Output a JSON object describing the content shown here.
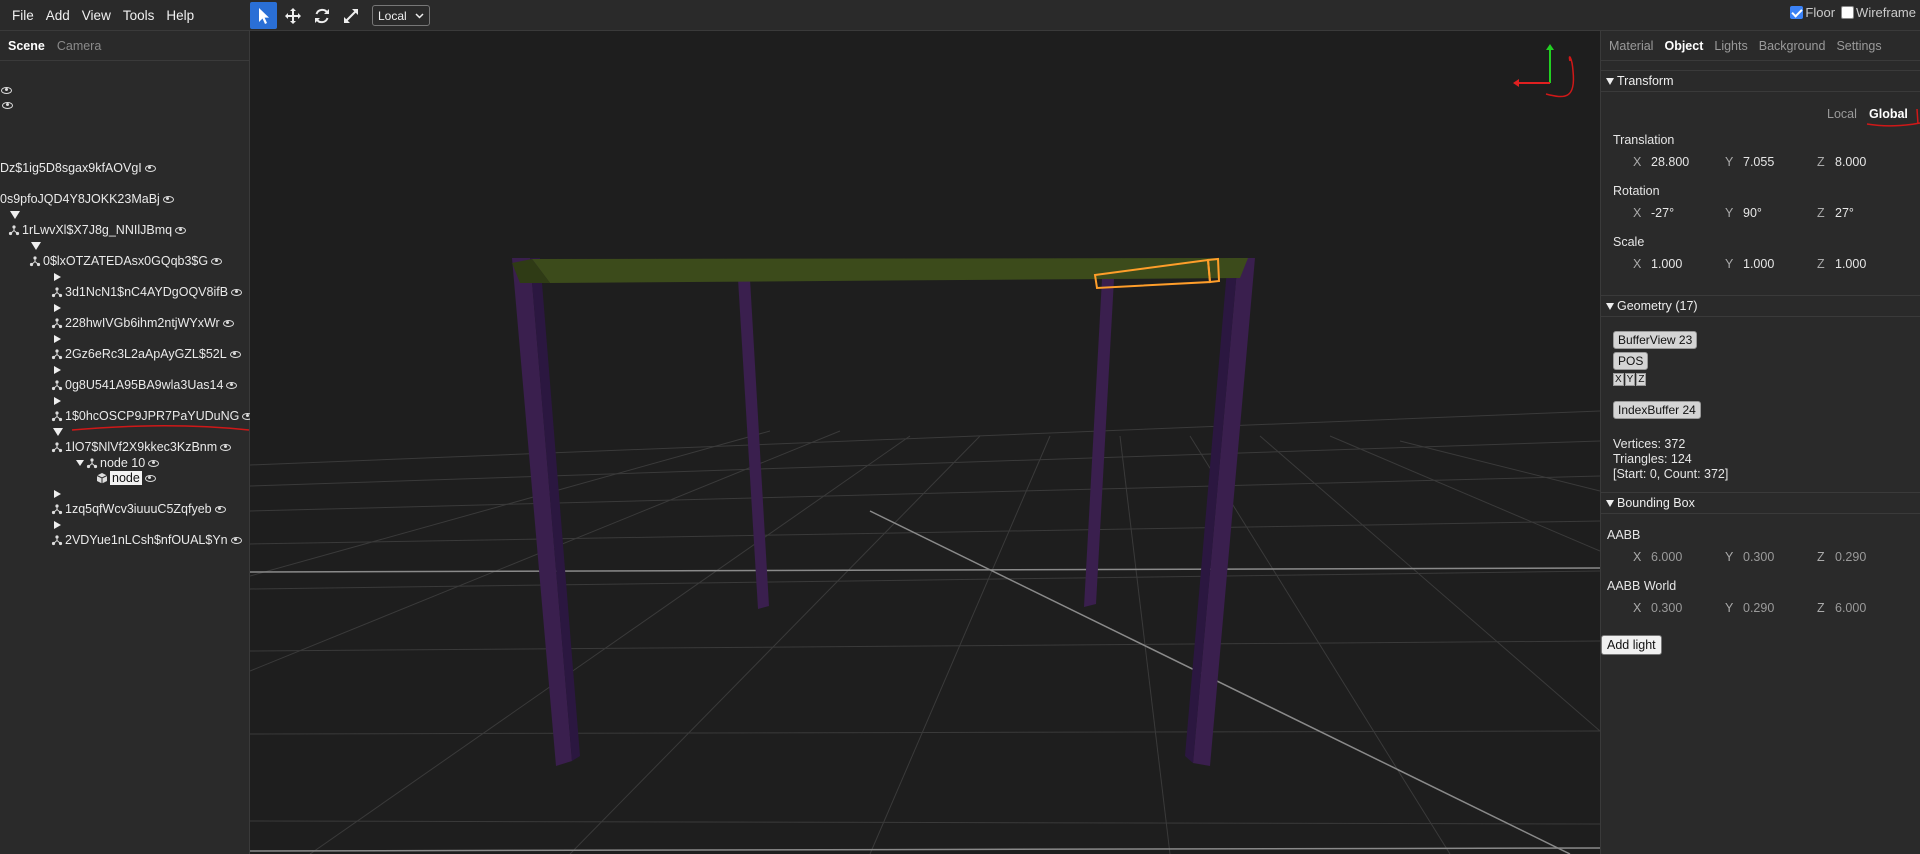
{
  "menu": [
    "File",
    "Add",
    "View",
    "Tools",
    "Help"
  ],
  "toolbar": {
    "space": "Local"
  },
  "toggles": {
    "floor": "Floor",
    "wireframe": "Wireframe"
  },
  "left_tabs": [
    "Scene",
    "Camera"
  ],
  "tree": [
    "Dz$1ig5D8sgax9kfAOVgI",
    "0s9pfoJQD4Y8JOKK23MaBj",
    "1rLwvXl$X7J8g_NNIlJBmq",
    "0$lxOTZATEDAsx0GQqb3$G",
    "3d1NcN1$nC4AYDgOQV8ifB",
    "228hwIVGb6ihm2ntjWYxWr",
    "2Gz6eRc3L2aApAyGZL$52L",
    "0g8U541A95BA9wla3Uas14",
    "1$0hcOSCP9JPR7PaYUDuNG",
    "1lO7$NlVf2X9kkec3KzBnm",
    "node 10",
    "node",
    "1zq5qfWcv3iuuuC5Zqfyeb",
    "2VDYue1nLCsh$nfOUAL$Yn"
  ],
  "right_tabs": [
    "Material",
    "Object",
    "Lights",
    "Background",
    "Settings"
  ],
  "transform": {
    "header": "Transform",
    "space_local": "Local",
    "space_global": "Global",
    "translation_label": "Translation",
    "translation": {
      "x": "28.800",
      "y": "7.055",
      "z": "8.000"
    },
    "rotation_label": "Rotation",
    "rotation": {
      "x": "-27°",
      "y": "90°",
      "z": "27°"
    },
    "scale_label": "Scale",
    "scale": {
      "x": "1.000",
      "y": "1.000",
      "z": "1.000"
    },
    "axes": {
      "x": "X",
      "y": "Y",
      "z": "Z"
    }
  },
  "geometry": {
    "header": "Geometry (17)",
    "buffer_view": "BufferView 23",
    "pos": "POS",
    "mini": [
      "X",
      "Y",
      "Z"
    ],
    "index_buffer": "IndexBuffer 24",
    "vertices": "Vertices: 372",
    "triangles": "Triangles: 124",
    "range": "[Start: 0, Count: 372]"
  },
  "bbox": {
    "header": "Bounding Box",
    "aabb_label": "AABB",
    "aabb": {
      "x": "6.000",
      "y": "0.300",
      "z": "0.290"
    },
    "world_label": "AABB World",
    "world": {
      "x": "0.300",
      "y": "0.290",
      "z": "6.000"
    }
  },
  "add_light": "Add light",
  "colors": {
    "accent": "#2a6fd6",
    "table_top": "#3a4a1a",
    "legs": "#3a1f4e",
    "selection": "#ff9e2a"
  }
}
